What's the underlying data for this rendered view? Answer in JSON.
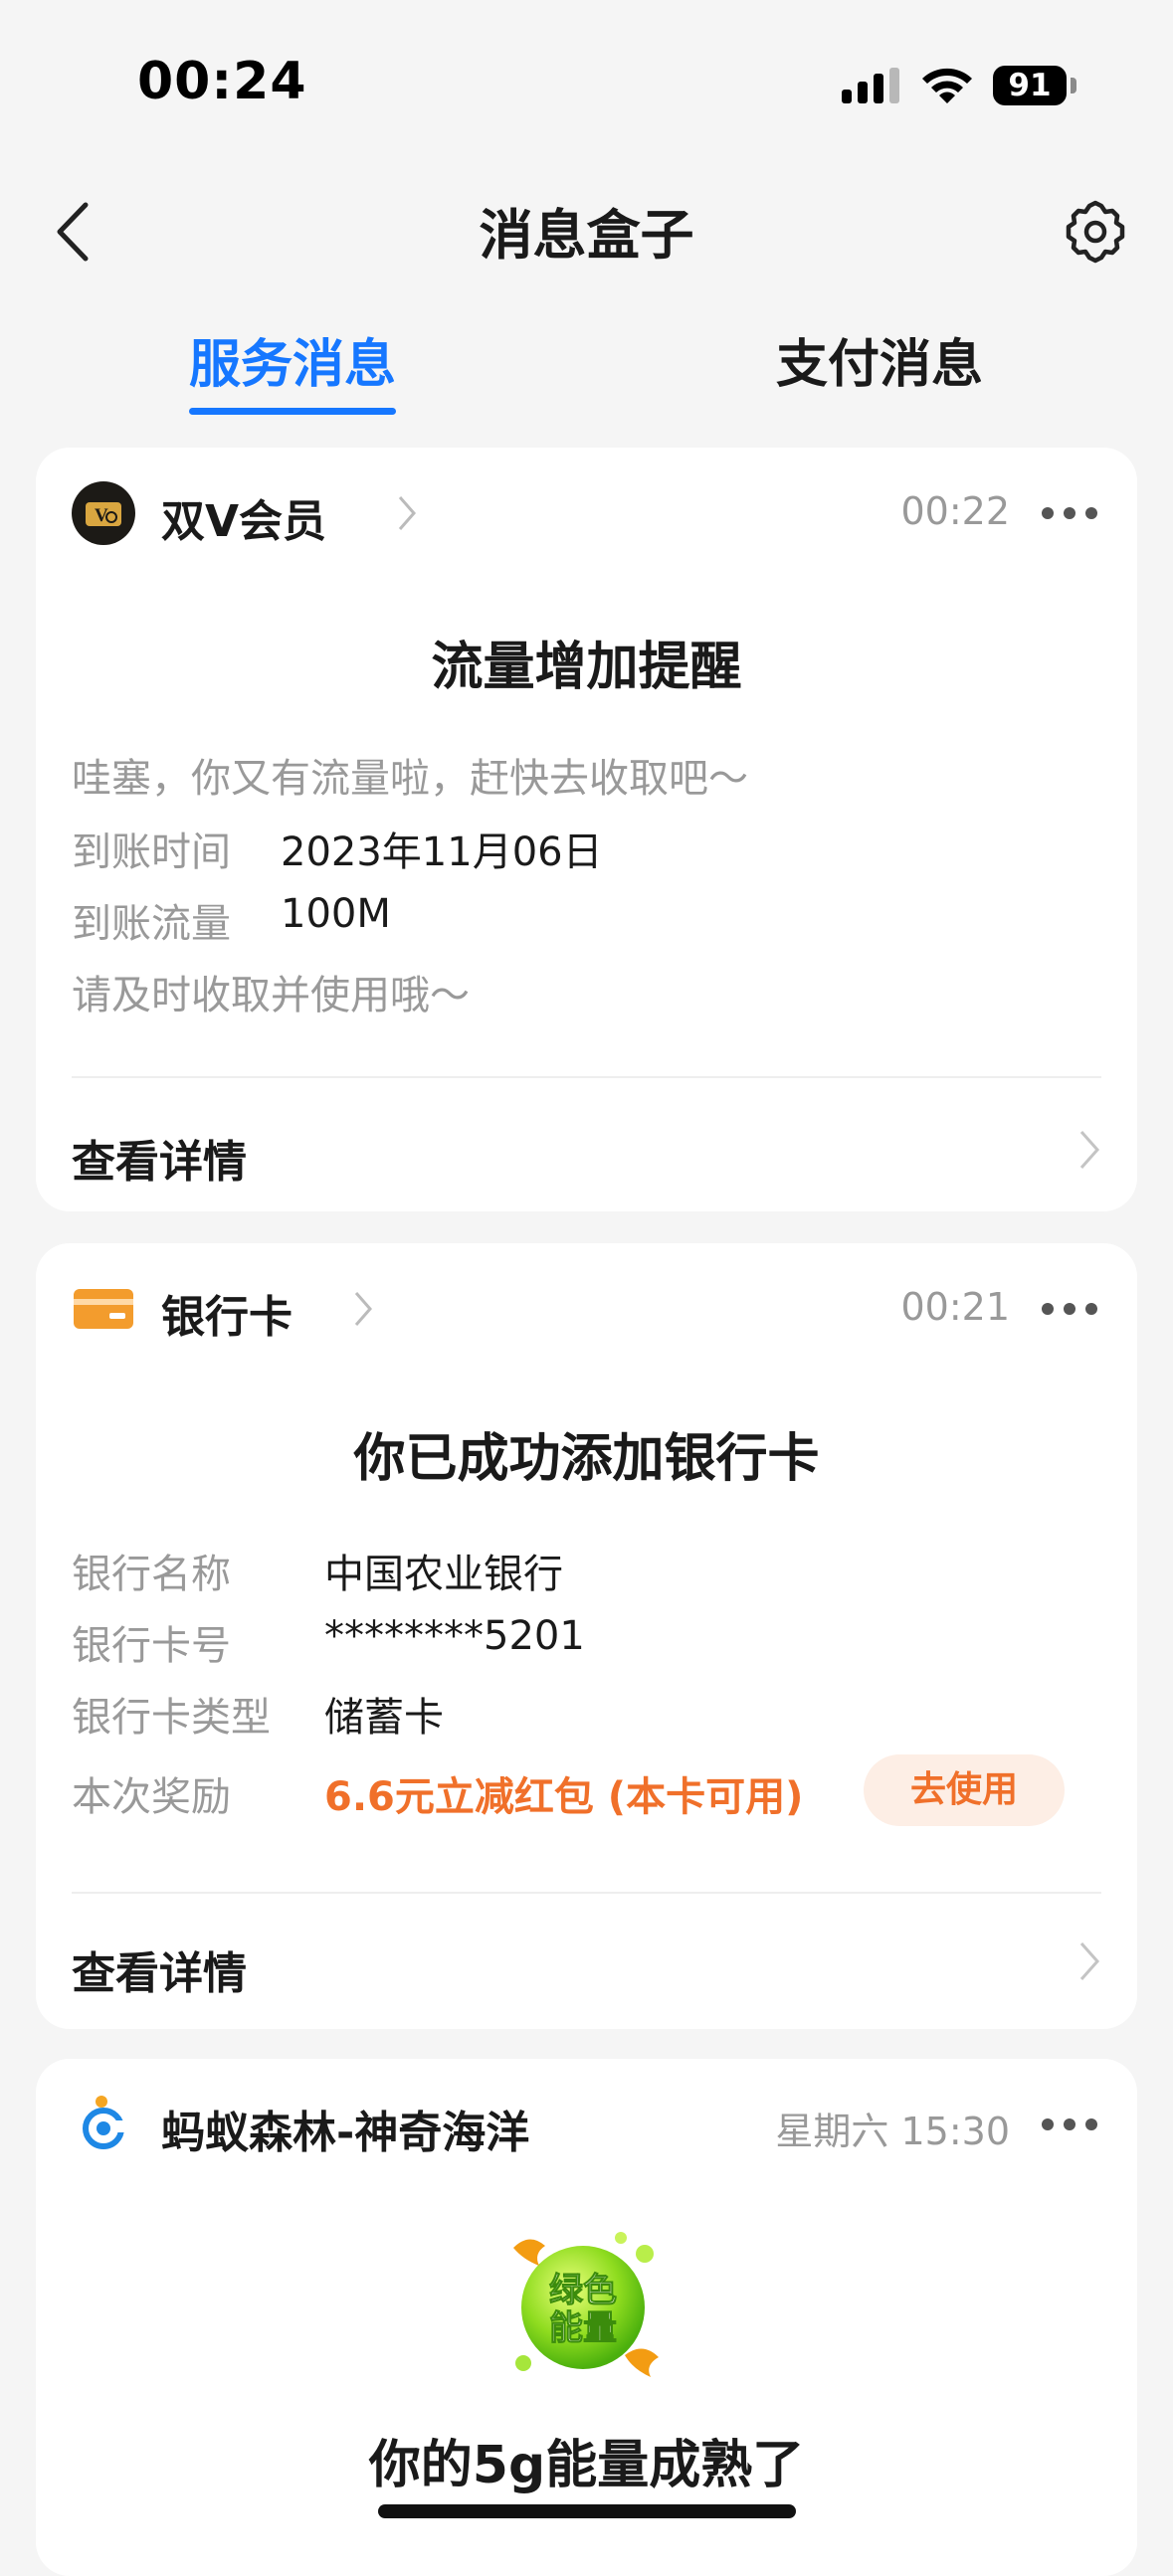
{
  "status_bar": {
    "time": "00:24",
    "battery": "91"
  },
  "nav": {
    "title": "消息盒子"
  },
  "tabs": [
    {
      "label": "服务消息",
      "active": true
    },
    {
      "label": "支付消息",
      "active": false
    }
  ],
  "cards": [
    {
      "sender": "双V会员",
      "time": "00:22",
      "title": "流量增加提醒",
      "intro": "哇塞，你又有流量啦，赶快去收取吧～",
      "rows": [
        {
          "label": "到账时间",
          "value": "2023年11月06日"
        },
        {
          "label": "到账流量",
          "value": "100M"
        }
      ],
      "note": "请及时收取并使用哦～",
      "detail": "查看详情"
    },
    {
      "sender": "银行卡",
      "time": "00:21",
      "title": "你已成功添加银行卡",
      "rows": [
        {
          "label": "银行名称",
          "value": "中国农业银行"
        },
        {
          "label": "银行卡号",
          "value": "********5201"
        },
        {
          "label": "银行卡类型",
          "value": "储蓄卡"
        },
        {
          "label": "本次奖励",
          "value": "6.6元立减红包 (本卡可用)"
        }
      ],
      "action": "去使用",
      "detail": "查看详情"
    },
    {
      "sender": "蚂蚁森林-神奇海洋",
      "time": "星期六 15:30",
      "badge_text": "绿色能量",
      "title": "你的5g能量成熟了"
    }
  ],
  "colors": {
    "accent": "#1677ff",
    "reward": "#f0702a",
    "background": "#f5f5f5"
  }
}
